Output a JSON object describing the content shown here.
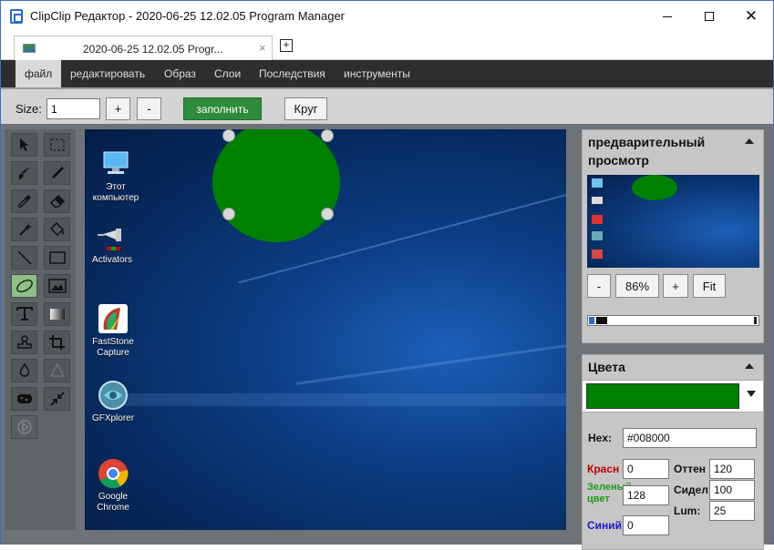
{
  "window": {
    "title": "ClipClip Редактор - 2020-06-25 12.02.05 Program Manager",
    "minimize_glyph": "—",
    "close_glyph": "✕"
  },
  "tab": {
    "title": "2020-06-25 12.02.05 Progr...",
    "close_glyph": "×",
    "new_tab_glyph": "+"
  },
  "menu": {
    "items": [
      "файл",
      "редактировать",
      "Образ",
      "Слои",
      "Последствия",
      "инструменты"
    ]
  },
  "options": {
    "size_label": "Size:",
    "size_value": "1",
    "plus_label": "+",
    "minus_label": "-",
    "fill_label": "заполнить",
    "shape_label": "Круг"
  },
  "tools": [
    {
      "name": "select-pointer-icon"
    },
    {
      "name": "marquee-select-icon"
    },
    {
      "name": "paintbrush-icon"
    },
    {
      "name": "pencil-icon"
    },
    {
      "name": "eyedropper-icon"
    },
    {
      "name": "eraser-icon"
    },
    {
      "name": "magic-wand-icon"
    },
    {
      "name": "fill-bucket-icon"
    },
    {
      "name": "line-icon"
    },
    {
      "name": "rectangle-icon"
    },
    {
      "name": "ellipse-icon"
    },
    {
      "name": "image-icon"
    },
    {
      "name": "text-icon"
    },
    {
      "name": "gradient-icon"
    },
    {
      "name": "stamp-icon"
    },
    {
      "name": "crop-icon"
    },
    {
      "name": "blur-drop-icon"
    },
    {
      "name": "sharpen-triangle-icon"
    },
    {
      "name": "sponge-icon"
    },
    {
      "name": "shrink-icon"
    },
    {
      "name": "play-icon"
    }
  ],
  "canvas": {
    "shape_color": "#008000",
    "desktop_icons": [
      {
        "label": "Этот компьютер",
        "icon": "computer-icon"
      },
      {
        "label": "Activators",
        "icon": "pin-icon"
      },
      {
        "label": "FastStone Capture",
        "icon": "faststone-icon"
      },
      {
        "label": "GFXplorer",
        "icon": "gfxplorer-icon"
      },
      {
        "label": "Google Chrome",
        "icon": "chrome-icon"
      }
    ]
  },
  "preview": {
    "title": "предварительный просмотр",
    "zoom_value": "86%",
    "zoom_minus": "-",
    "zoom_plus": "+",
    "fit_label": "Fit"
  },
  "colors": {
    "title": "Цвета",
    "current_color": "#008000",
    "hex_label": "Hex:",
    "hex_value": "#008000",
    "red_label": "Красн",
    "red_value": "0",
    "green_label": "Зеленый цвет",
    "green_value": "128",
    "blue_label": "Синий",
    "blue_value": "0",
    "hue_label": "Оттен",
    "hue_value": "120",
    "sat_label": "Сидел",
    "sat_value": "100",
    "lum_label": "Lum:",
    "lum_value": "25",
    "red_color": "#c00000",
    "green_color": "#1a9a1a",
    "blue_color": "#1a1acc"
  }
}
